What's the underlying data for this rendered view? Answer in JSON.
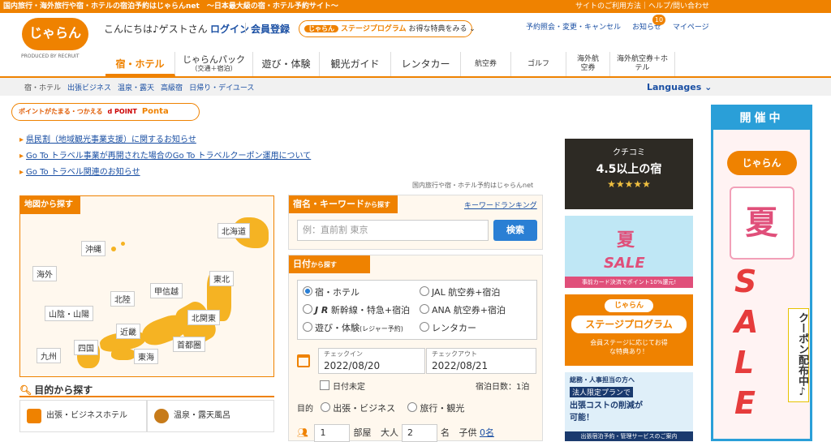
{
  "topbar": {
    "left": "国内旅行・海外旅行や宿・ホテルの宿泊予約はじゃらんnet　～日本最大級の宿・ホテル予約サイト～",
    "right": "サイトのご利用方法｜ヘルプ/問い合わせ"
  },
  "header": {
    "logo_text": "じゃらん",
    "produced_by": "PRODUCED BY RECRUIT",
    "greeting": "こんにちは♪ゲストさん",
    "login": "ログイン",
    "register": "会員登録",
    "stage_logo": "じゃらん",
    "stage_program": "ステージプログラム",
    "stage_cta": "お得な特典をみる ⌄",
    "links": [
      "予約照会・変更・キャンセル",
      "お知らせ",
      "マイページ"
    ],
    "notification_count": "10"
  },
  "nav": {
    "tabs": [
      "宿・ホテル",
      "じゃらんパック",
      "遊び・体験",
      "観光ガイド",
      "レンタカー",
      "航空券",
      "ゴルフ",
      "海外航空券",
      "海外航空券＋ホテル"
    ],
    "pack_sub": "（交通＋宿泊）"
  },
  "subnav": {
    "items": [
      "宿・ホテル",
      "出張ビジネス",
      "温泉・露天",
      "高級宿",
      "日帰り・デイユース"
    ],
    "languages": "Languages ⌄"
  },
  "points": {
    "label": "ポイントがたまる・つかえる",
    "dpoint": "d POINT",
    "ponta": "Ponta"
  },
  "notices": [
    "県民割（地域観光事業支援）に関するお知らせ",
    "Go To トラベル事業が再開された場合のGo To トラベルクーポン運用について",
    "Go To トラベル関連のお知らせ"
  ],
  "page_tag": "国内旅行や宿・ホテル予約はじゃらんnet",
  "map": {
    "title": "地図から探す",
    "regions": [
      "北海道",
      "沖縄",
      "海外",
      "東北",
      "甲信越",
      "北陸",
      "北関東",
      "山陰・山陽",
      "近畿",
      "首都圏",
      "四国",
      "九州",
      "東海"
    ]
  },
  "purpose": {
    "title": "目的から探す",
    "items": [
      "出張・ビジネスホテル",
      "温泉・露天風呂"
    ]
  },
  "keyword": {
    "title": "宿名・キーワード",
    "title_small": "から探す",
    "ranking": "キーワードランキング",
    "placeholder": "例：直前割 東京",
    "search": "検索"
  },
  "date": {
    "title": "日付",
    "title_small": "から探す",
    "options": [
      "宿・ホテル",
      "JR新幹線・特急+宿泊",
      "遊び・体験",
      "JAL 航空券+宿泊",
      "ANA 航空券+宿泊",
      "レンタカー"
    ],
    "jr_suffix": "新幹線・特急+宿泊",
    "activity_sub": "(レジャー予約)",
    "checkin_label": "チェックイン",
    "checkin": "2022/08/20",
    "checkout_label": "チェックアウト",
    "checkout": "2022/08/21",
    "undecided": "日付未定",
    "nights": "宿泊日数：1泊",
    "purpose_label": "目的",
    "purpose_options": [
      "出張・ビジネス",
      "旅行・観光"
    ],
    "rooms_value": "1",
    "rooms_unit": "部屋",
    "adults_label": "大人",
    "adults_value": "2",
    "adults_unit": "名",
    "children_label": "子供",
    "children_value": "0名"
  },
  "ads": {
    "ad1_title": "クチコミ",
    "ad1_main": "4.5以上の宿",
    "ad1_stars": "★★★★★",
    "ad2_title": "夏",
    "ad2_sale": "SALE",
    "ad2_note": "事前カード決済でポイント10%還元!",
    "ad3_logo": "じゃらん",
    "ad3_title": "ステージプログラム",
    "ad3_note": "会員ステージに応じてお得な特典あり！",
    "ad4_line1": "総務・人事担当の方へ",
    "ad4_line2": "法人限定プランで",
    "ad4_line3": "出張コストの削減が可能！",
    "ad4_line4": "出張宿泊予約・管理サービスのご案内",
    "big_top": "開催中",
    "big_logo": "じゃらん",
    "big_summer": "夏",
    "big_sale": "SALE",
    "big_coupon": "クーポン配布中♪"
  },
  "colors": {
    "brand": "#ef8200",
    "link": "#1a4fa3",
    "button": "#2a7fd4"
  }
}
